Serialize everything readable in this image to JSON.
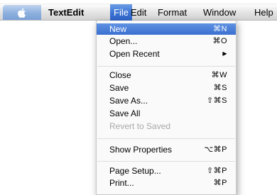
{
  "menubar": {
    "apple_icon": "apple-icon",
    "items": [
      "TextEdit",
      "File",
      "Edit",
      "Format",
      "Window",
      "Help"
    ],
    "active_item": "File",
    "active_color": "#3a72d2"
  },
  "file_menu": {
    "items": [
      {
        "label": "New",
        "shortcut": "⌘N",
        "state": "highlighted"
      },
      {
        "label": "Open...",
        "shortcut": "⌘O"
      },
      {
        "label": "Open Recent",
        "shortcut": "▶",
        "submenu": true
      },
      {
        "label": "Close",
        "shortcut": "⌘W"
      },
      {
        "label": "Save",
        "shortcut": "⌘S"
      },
      {
        "label": "Save As...",
        "shortcut": "⇧⌘S"
      },
      {
        "label": "Save All",
        "shortcut": ""
      },
      {
        "label": "Revert to Saved",
        "shortcut": "",
        "state": "disabled"
      },
      {
        "label": "Show Properties",
        "shortcut": "⌥⌘P"
      },
      {
        "label": "Page Setup...",
        "shortcut": "⇧⌘P"
      },
      {
        "label": "Print...",
        "shortcut": "⌘P"
      }
    ]
  }
}
